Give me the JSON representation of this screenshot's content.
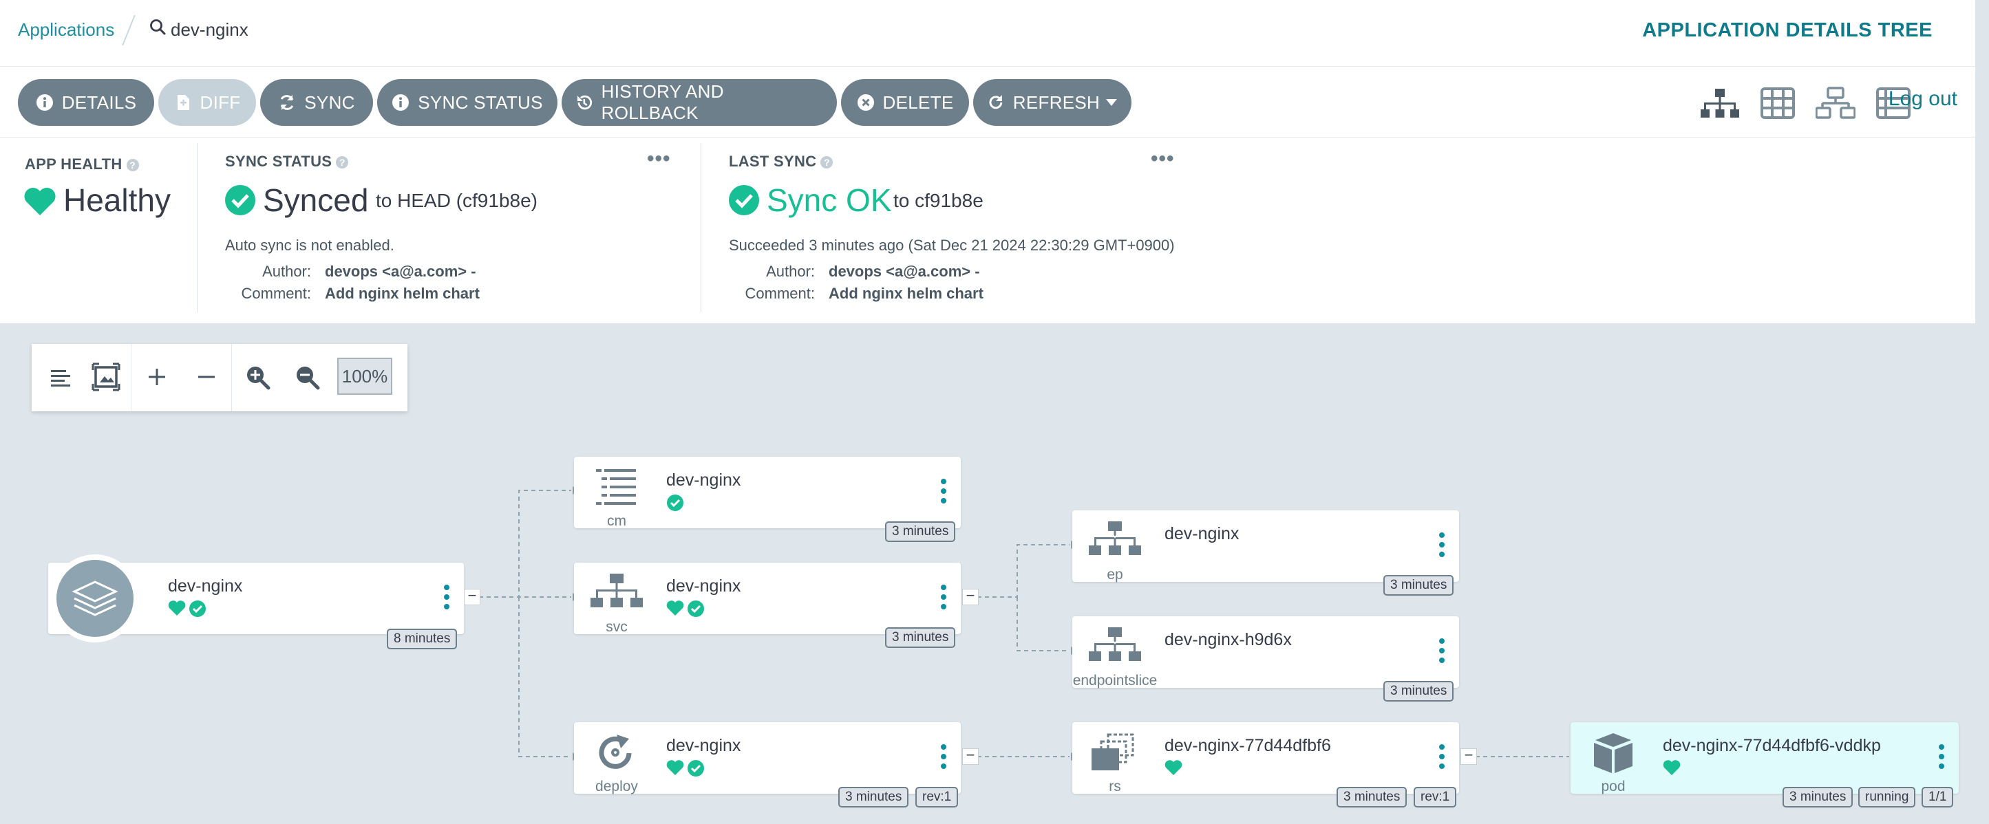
{
  "breadcrumb": {
    "applications": "Applications",
    "current": "dev-nginx"
  },
  "page_title": "APPLICATION DETAILS TREE",
  "toolbar": {
    "details": "DETAILS",
    "diff": "DIFF",
    "sync": "SYNC",
    "sync_status": "SYNC STATUS",
    "history": "HISTORY AND ROLLBACK",
    "delete": "DELETE",
    "refresh": "REFRESH",
    "logout": "Log out"
  },
  "app_health": {
    "label": "APP HEALTH",
    "value": "Healthy"
  },
  "sync_status": {
    "label": "SYNC STATUS",
    "value": "Synced",
    "target": "to HEAD (cf91b8e)",
    "auto_sync": "Auto sync is not enabled.",
    "author_key": "Author:",
    "author": "devops <a@a.com> -",
    "comment_key": "Comment:",
    "comment": "Add nginx helm chart"
  },
  "last_sync": {
    "label": "LAST SYNC",
    "value": "Sync OK",
    "target": "to cf91b8e",
    "succeeded": "Succeeded 3 minutes ago (Sat Dec 21 2024 22:30:29 GMT+0900)",
    "author_key": "Author:",
    "author": "devops <a@a.com> -",
    "comment_key": "Comment:",
    "comment": "Add nginx helm chart"
  },
  "zoom": {
    "level": "100%"
  },
  "colors": {
    "healthy": "#18be94",
    "accent": "#0f7a8a",
    "button": "#6d7f8b"
  },
  "nodes": {
    "app": {
      "name": "dev-nginx",
      "age": "8 minutes"
    },
    "cm": {
      "name": "dev-nginx",
      "kind": "cm",
      "age": "3 minutes"
    },
    "svc": {
      "name": "dev-nginx",
      "kind": "svc",
      "age": "3 minutes"
    },
    "deploy": {
      "name": "dev-nginx",
      "kind": "deploy",
      "age": "3 minutes",
      "rev": "rev:1"
    },
    "ep": {
      "name": "dev-nginx",
      "kind": "ep",
      "age": "3 minutes"
    },
    "endpointslice": {
      "name": "dev-nginx-h9d6x",
      "kind": "endpointslice",
      "age": "3 minutes"
    },
    "rs": {
      "name": "dev-nginx-77d44dfbf6",
      "kind": "rs",
      "age": "3 minutes",
      "rev": "rev:1"
    },
    "pod": {
      "name": "dev-nginx-77d44dfbf6-vddkp",
      "kind": "pod",
      "age": "3 minutes",
      "state": "running",
      "ready": "1/1"
    }
  }
}
